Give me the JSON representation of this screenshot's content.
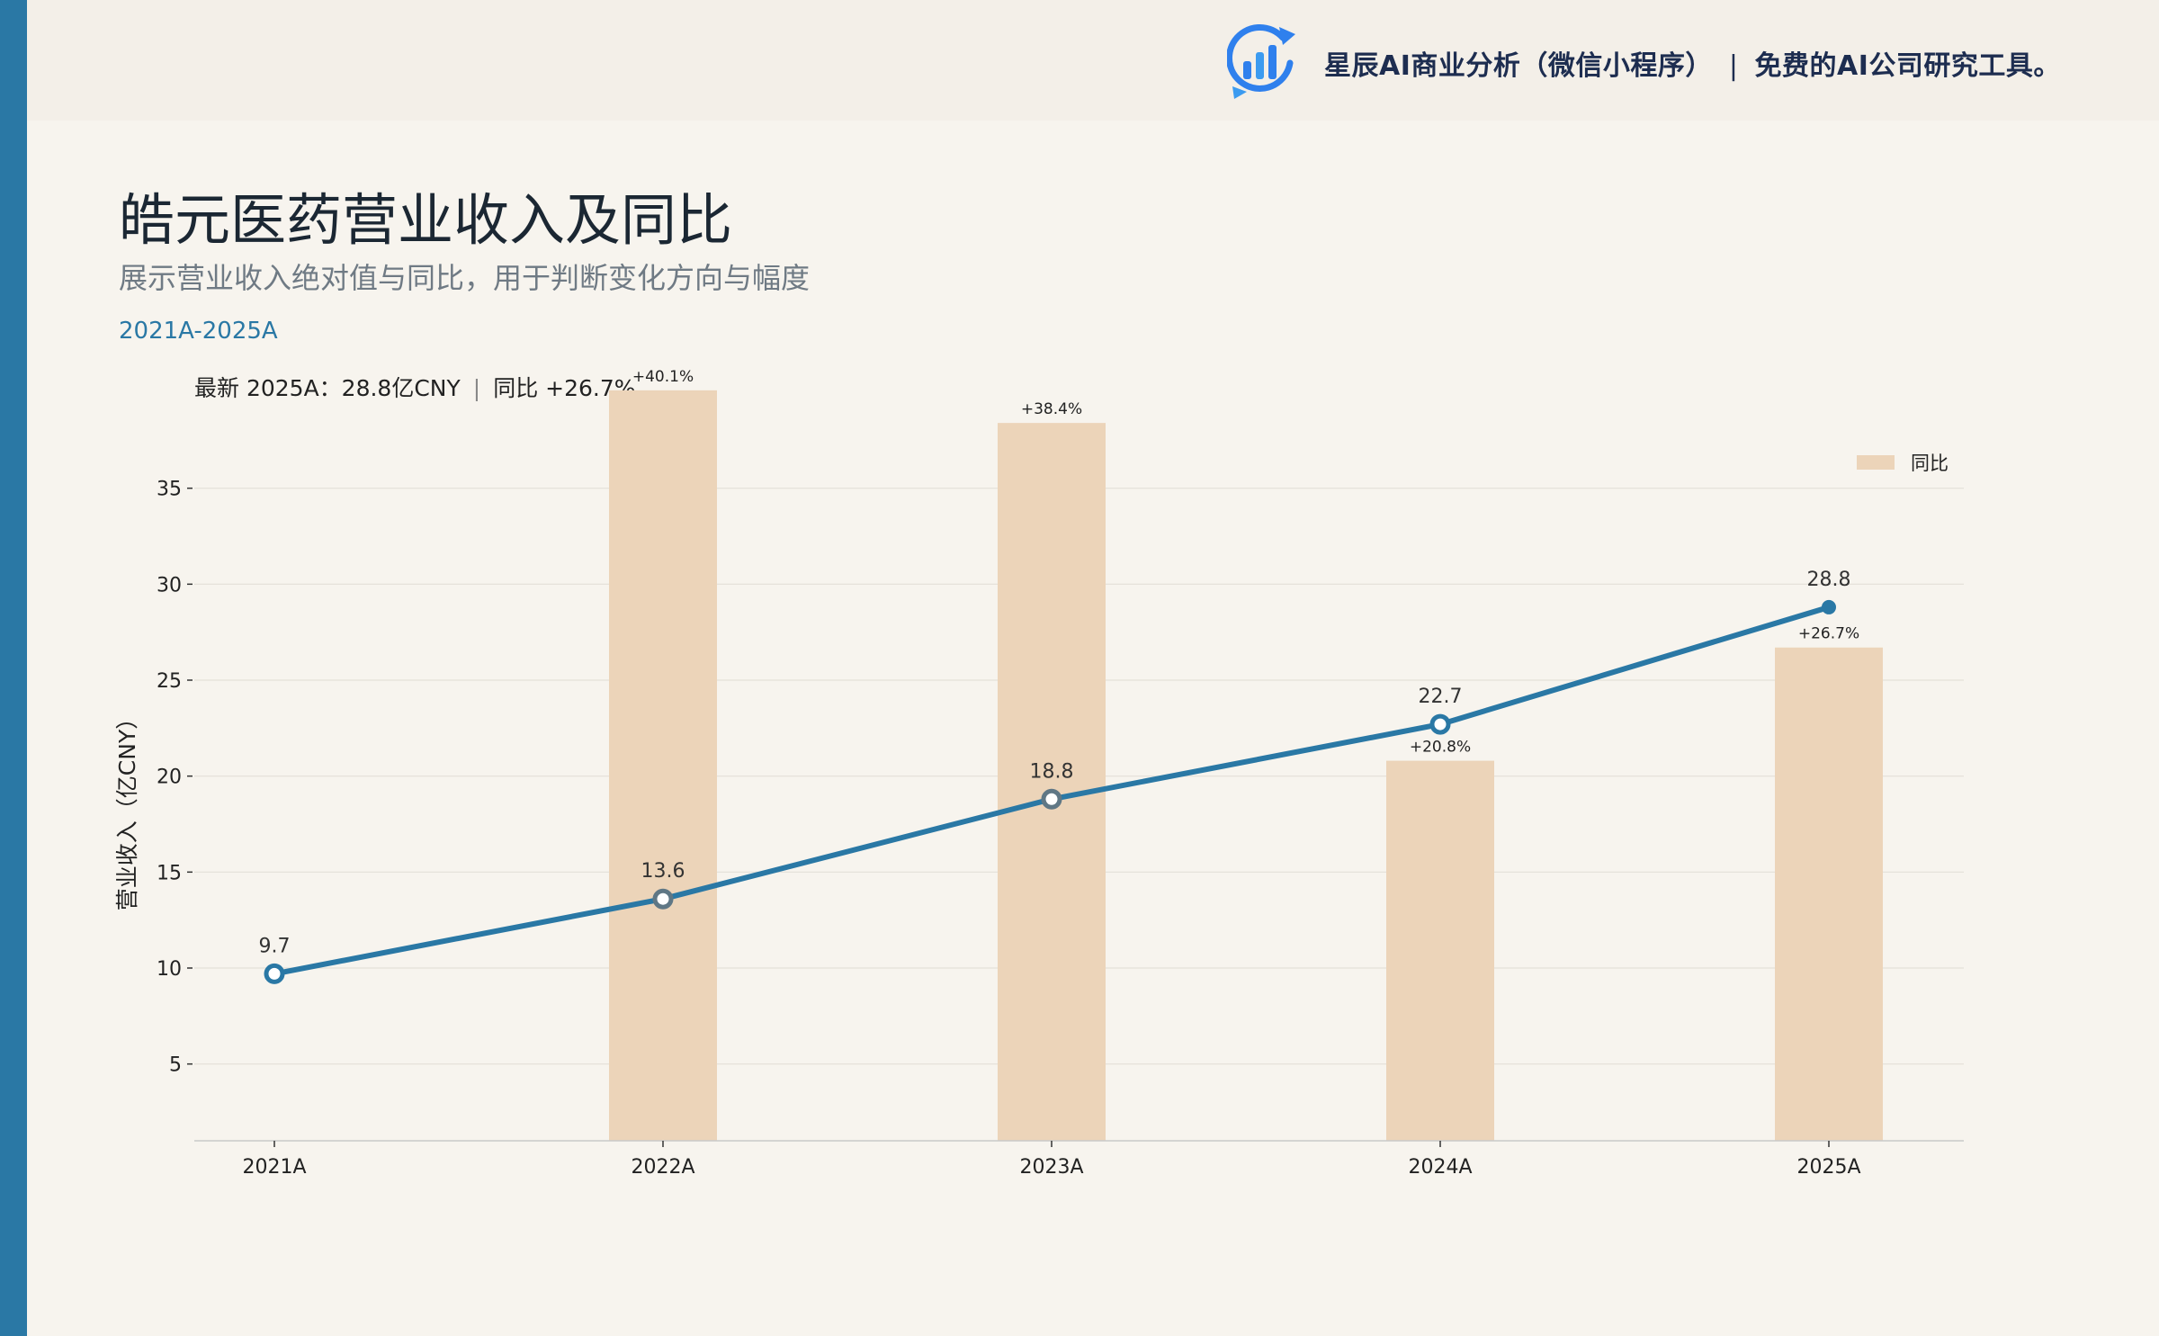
{
  "header": {
    "brand_name": "星辰AI商业分析（微信小程序）",
    "brand_separator": "|",
    "brand_slogan": "免费的AI公司研究工具。",
    "logo_icon": "bar-chart-refresh-logo"
  },
  "page": {
    "title": "皓元医药营业收入及同比",
    "subtitle": "展示营业收入绝对值与同比，用于判断变化方向与幅度",
    "period": "2021A-2025A",
    "latest_label": "最新 2025A：28.8亿CNY",
    "latest_sep": "|",
    "latest_yoy": "同比 +26.7%"
  },
  "colors": {
    "accent": "#2a78a5",
    "bar": "#ecd4b9",
    "background": "#f7f4ee",
    "topbar": "#f3efe8"
  },
  "chart_data": {
    "type": "bar+line",
    "categories": [
      "2021A",
      "2022A",
      "2023A",
      "2024A",
      "2025A"
    ],
    "ylabel": "营业收入（亿CNY）",
    "ylim": [
      1,
      37
    ],
    "yticks": [
      5,
      10,
      15,
      20,
      25,
      30,
      35
    ],
    "grid": true,
    "legend_position": "top-right",
    "series": [
      {
        "name": "营业收入",
        "kind": "line",
        "values": [
          9.7,
          13.6,
          18.8,
          22.7,
          28.8
        ],
        "labels": [
          "9.7",
          "13.6",
          "18.8",
          "22.7",
          "28.8"
        ]
      },
      {
        "name": "同比",
        "kind": "bar",
        "values": [
          null,
          40.1,
          38.4,
          20.8,
          26.7
        ],
        "labels": [
          "",
          "+40.1%",
          "+38.4%",
          "+20.8%",
          "+26.7%"
        ]
      }
    ]
  }
}
